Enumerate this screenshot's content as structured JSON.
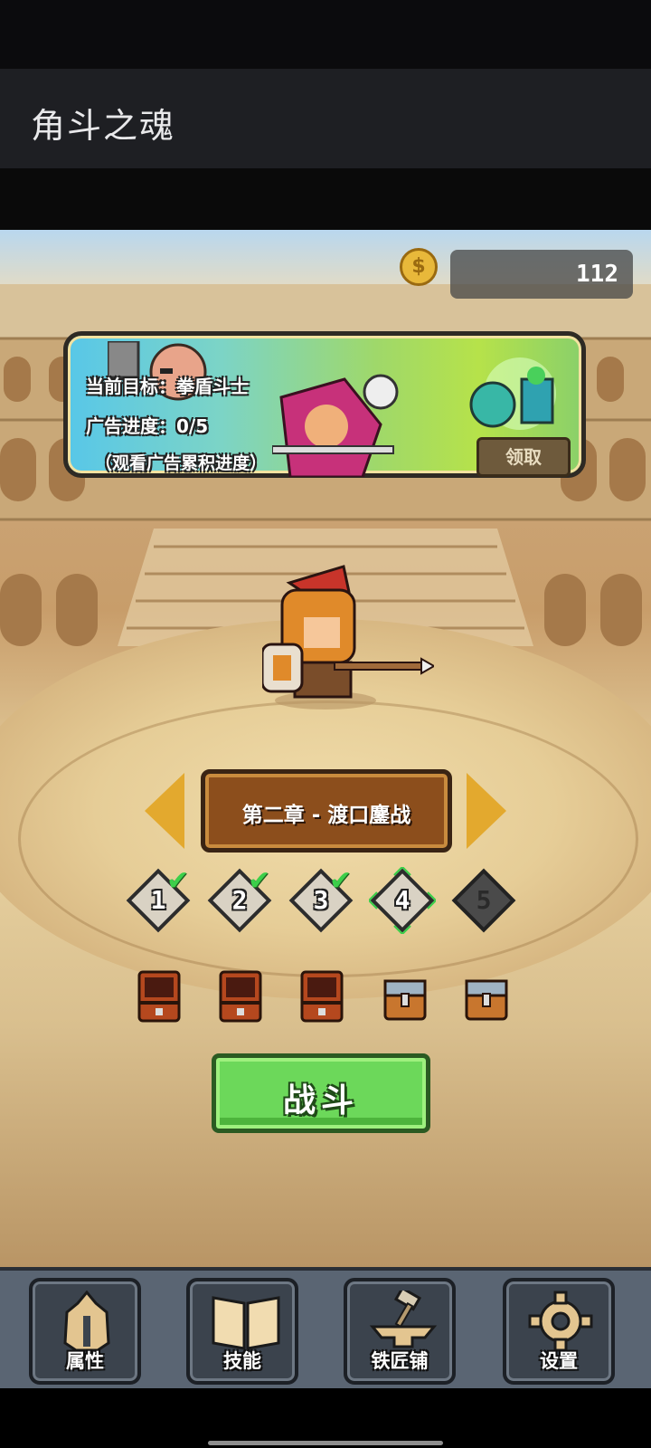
{
  "app": {
    "title": "角斗之魂"
  },
  "currency": {
    "icon": "gold-coin-icon",
    "value": "112"
  },
  "quest": {
    "target_label": "当前目标：",
    "target_value": "拳盾斗士",
    "ad_progress_label": "广告进度：",
    "ad_progress_value": "0/5",
    "hint": "（观看广告累积进度）",
    "claim_label": "领取"
  },
  "chapter": {
    "title": "第二章 - 渡口鏖战"
  },
  "stages": [
    {
      "number": "1",
      "state": "completed"
    },
    {
      "number": "2",
      "state": "completed"
    },
    {
      "number": "3",
      "state": "completed"
    },
    {
      "number": "4",
      "state": "current"
    },
    {
      "number": "5",
      "state": "locked"
    }
  ],
  "chests": [
    "opened",
    "opened",
    "opened",
    "closed",
    "closed"
  ],
  "fight_button": {
    "label": "战斗"
  },
  "nav": [
    {
      "label": "属性",
      "icon": "spartan-helmet-icon"
    },
    {
      "label": "技能",
      "icon": "book-icon"
    },
    {
      "label": "铁匠铺",
      "icon": "anvil-hammer-icon"
    },
    {
      "label": "设置",
      "icon": "gear-icon"
    }
  ],
  "colors": {
    "accent_gold": "#e3a92e",
    "fight_green": "#6cd85a",
    "check_green": "#3ccf4a",
    "chapter_brown": "#8c4e1c"
  }
}
